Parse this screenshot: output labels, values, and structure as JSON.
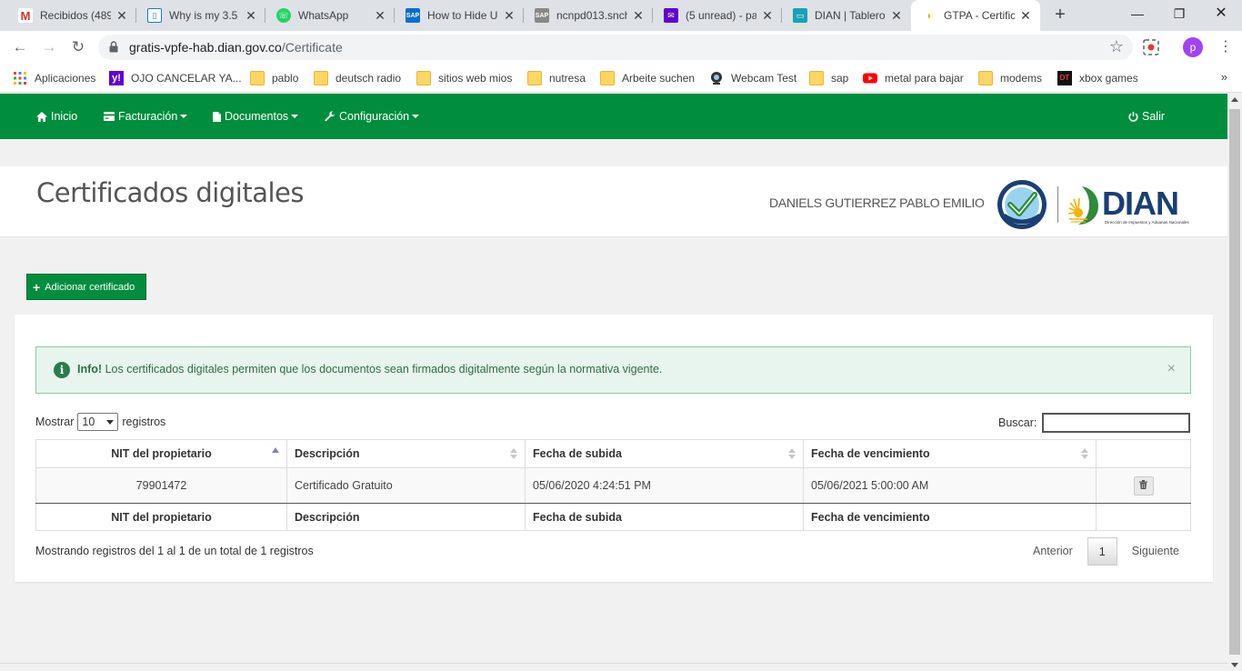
{
  "browser": {
    "tabs": [
      {
        "label": "Recibidos (489",
        "icon": "gmail-icon",
        "color": "#d93025"
      },
      {
        "label": "Why is my 3.5",
        "icon": "page-icon",
        "color": "#1a73e8"
      },
      {
        "label": "WhatsApp",
        "icon": "whatsapp-icon",
        "color": "#25d366"
      },
      {
        "label": "How to Hide U",
        "icon": "sap-icon",
        "color": "#0a6ed1"
      },
      {
        "label": "ncnpd013.snch",
        "icon": "sap-icon",
        "color": "#555555"
      },
      {
        "label": "(5 unread) - pa",
        "icon": "yahoo-mail-icon",
        "color": "#6001d2"
      },
      {
        "label": "DIAN | Tablero",
        "icon": "dian-tab-icon",
        "color": "#17a2b8"
      },
      {
        "label": "GTPA - Certific",
        "icon": "dian-logo-icon",
        "color": "#f2b400"
      }
    ],
    "new_tab": "+",
    "address": {
      "host": "gratis-vpfe-hab.dian.gov.co",
      "path": "/Certificate"
    },
    "profile_initial": "p",
    "bookmarks": [
      {
        "label": "Aplicaciones",
        "icon": "apps-grid-icon"
      },
      {
        "label": "OJO CANCELAR YA...",
        "icon": "yahoo-icon"
      },
      {
        "label": "pablo",
        "icon": "folder-icon"
      },
      {
        "label": "deutsch radio",
        "icon": "folder-icon"
      },
      {
        "label": "sitios web mios",
        "icon": "folder-icon"
      },
      {
        "label": "nutresa",
        "icon": "folder-icon"
      },
      {
        "label": "Arbeite suchen",
        "icon": "folder-icon"
      },
      {
        "label": "Webcam Test",
        "icon": "webcam-icon"
      },
      {
        "label": "sap",
        "icon": "folder-icon"
      },
      {
        "label": "metal para bajar",
        "icon": "youtube-icon"
      },
      {
        "label": "modems",
        "icon": "folder-icon"
      },
      {
        "label": "xbox games",
        "icon": "xbox-site-icon"
      }
    ],
    "bookmarks_more": "»"
  },
  "nav": {
    "items": [
      {
        "label": "Inicio",
        "icon": "home-icon",
        "dropdown": false
      },
      {
        "label": "Facturación",
        "icon": "credit-card-icon",
        "dropdown": true
      },
      {
        "label": "Documentos",
        "icon": "document-icon",
        "dropdown": true
      },
      {
        "label": "Configuración",
        "icon": "wrench-icon",
        "dropdown": true
      }
    ],
    "logout": {
      "label": "Salir",
      "icon": "power-icon"
    },
    "color": "#008d3e"
  },
  "header": {
    "title": "Certificados digitales",
    "user_name": "DANIELS GUTIERREZ PABLO EMILIO",
    "dian_logo_text": "DIAN",
    "dian_logo_sub": "Dirección de Impuestos y Aduanas Nacionales"
  },
  "add_button": {
    "label": "Adicionar certificado"
  },
  "alert": {
    "title": "Info!",
    "message": "Los certificados digitales permiten que los documentos sean firmados digitalmente según la normativa vigente.",
    "close": "×"
  },
  "table_controls": {
    "show_prefix": "Mostrar",
    "page_length": "10",
    "show_suffix": "registros",
    "search_label": "Buscar:",
    "search_value": ""
  },
  "table": {
    "columns": [
      "NIT del propietario",
      "Descripción",
      "Fecha de subida",
      "Fecha de vencimiento",
      ""
    ],
    "rows": [
      {
        "nit": "79901472",
        "descripcion": "Certificado Gratuito",
        "fecha_subida": "05/06/2020 4:24:51 PM",
        "fecha_vencimiento": "05/06/2021 5:00:00 AM"
      }
    ]
  },
  "footer": {
    "info": "Mostrando registros del 1 al 1 de un total de 1 registros",
    "prev": "Anterior",
    "current_page": "1",
    "next": "Siguiente"
  }
}
